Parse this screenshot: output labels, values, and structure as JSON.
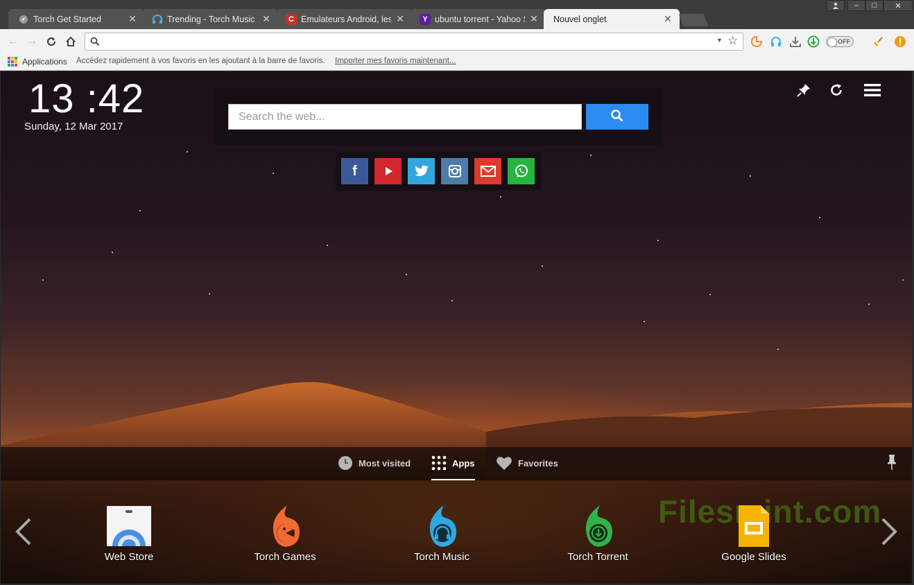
{
  "browser": {
    "tabs": [
      {
        "title": "Torch Get Started",
        "favicon": "torch-icon",
        "active": false
      },
      {
        "title": "Trending - Torch Music",
        "favicon": "headphones-icon",
        "active": false
      },
      {
        "title": "Emulateurs Android, les",
        "favicon": "clubic-icon",
        "favicon_text": "C",
        "active": false
      },
      {
        "title": "ubuntu torrent - Yahoo S",
        "favicon": "yahoo-icon",
        "favicon_text": "Y",
        "active": false
      },
      {
        "title": "Nouvel onglet",
        "favicon": "",
        "active": true
      }
    ],
    "window_controls": [
      "user",
      "minimize",
      "maximize",
      "close"
    ],
    "toggle_label": "OFF"
  },
  "bookmarks": {
    "apps_label": "Applications",
    "hint": "Accédez rapidement à vos favoris en les ajoutant à la barre de favoris.",
    "import_link": "Importer mes favoris maintenant..."
  },
  "page": {
    "clock_time": "13 :42",
    "clock_date": "Sunday,  12  Mar 2017",
    "search_placeholder": "Search the web...",
    "social": [
      "facebook",
      "youtube",
      "twitter",
      "instagram",
      "email",
      "whatsapp"
    ],
    "bottom_tabs": [
      {
        "label": "Most visited",
        "icon": "clock-icon"
      },
      {
        "label": "Apps",
        "icon": "grid-icon"
      },
      {
        "label": "Favorites",
        "icon": "heart-icon"
      }
    ],
    "apps": [
      {
        "label": "Web Store",
        "icon": "webstore-icon"
      },
      {
        "label": "Torch Games",
        "icon": "torch-games-icon"
      },
      {
        "label": "Torch Music",
        "icon": "torch-music-icon"
      },
      {
        "label": "Torch Torrent",
        "icon": "torch-torrent-icon"
      },
      {
        "label": "Google Slides",
        "icon": "google-slides-icon"
      }
    ],
    "watermark": "Filesmint.com"
  },
  "colors": {
    "search_button": "#2a8cf0",
    "facebook": "#3b5998",
    "youtube": "#d0282b",
    "twitter": "#33a6dd",
    "instagram": "#4d7ca8",
    "email": "#dd3b2c",
    "whatsapp": "#25b440"
  }
}
